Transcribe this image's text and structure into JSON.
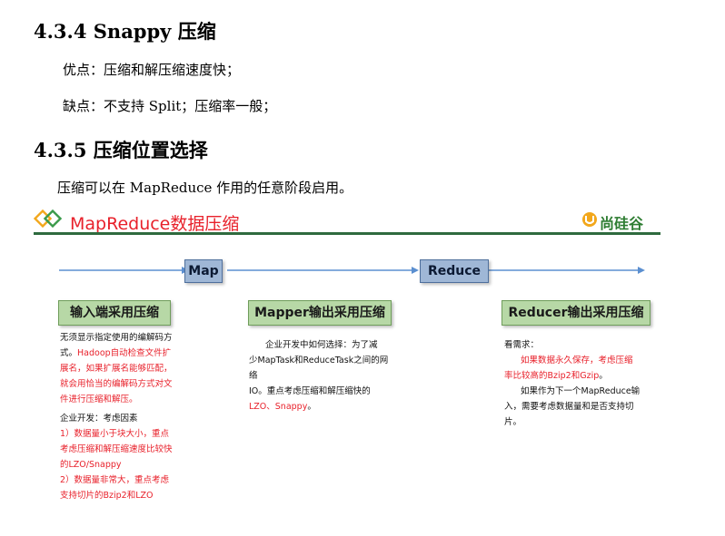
{
  "section_435_heading": "4.3.4 Snappy 压缩",
  "pros_line": "优点：压缩和解压缩速度快；",
  "cons_line": "缺点：不支持 Split；压缩率一般；",
  "section_435b_heading": "4.3.5  压缩位置选择",
  "intro_line": "压缩可以在 MapReduce 作用的任意阶段启用。",
  "banner": {
    "title": "MapReduce数据压缩",
    "brand": "尚硅谷"
  },
  "flow": {
    "stages": [
      "Map",
      "Reduce"
    ]
  },
  "cards": {
    "input": {
      "header": "输入端采用压缩",
      "p1_a": "无须显示指定使用的编解码方",
      "p1_b": "式。",
      "p1_red_a": "Hadoop自动检查文件扩",
      "p1_red_b": "展名，如果扩展名能够匹配，",
      "p1_red_c": "就会用恰当的编解码方式对文",
      "p1_red_d": "件进行压缩和解压。",
      "p2": "企业开发：考虑因素",
      "p2_red_a": "1）数据量小于块大小，重点",
      "p2_red_b": "考虑压缩和解压缩速度比较快",
      "p2_red_c": "的LZO/Snappy",
      "p2_red_d": "2）数据量非常大，重点考虑",
      "p2_red_e": "支持切片的Bzip2和LZO"
    },
    "mapper": {
      "header": "Mapper输出采用压缩",
      "line_a": "企业开发中如何选择：为了减",
      "line_b": "少MapTask和ReduceTask之间的网络",
      "line_c": "IO。重点考虑压缩和解压缩快的",
      "line_d_red": "LZO、Snappy",
      "line_d_end": "。"
    },
    "reducer": {
      "header": "Reducer输出采用压缩",
      "line_a": "看需求：",
      "line_b_red": "如果数据永久保存，考虑压缩",
      "line_c_red": "率比较高的Bzip2和Gzip",
      "line_c_end": "。",
      "line_d": "如果作为下一个MapReduce输",
      "line_e": "入，需要考虑数据量和是否支持切",
      "line_f": "片。"
    }
  },
  "colors": {
    "accent_red": "#e8212b",
    "rule_green": "#2e6a3e",
    "header_green": "#b7d8a6",
    "stage_blue": "#9fb7d6",
    "arrow_blue": "#5b8fd0"
  }
}
